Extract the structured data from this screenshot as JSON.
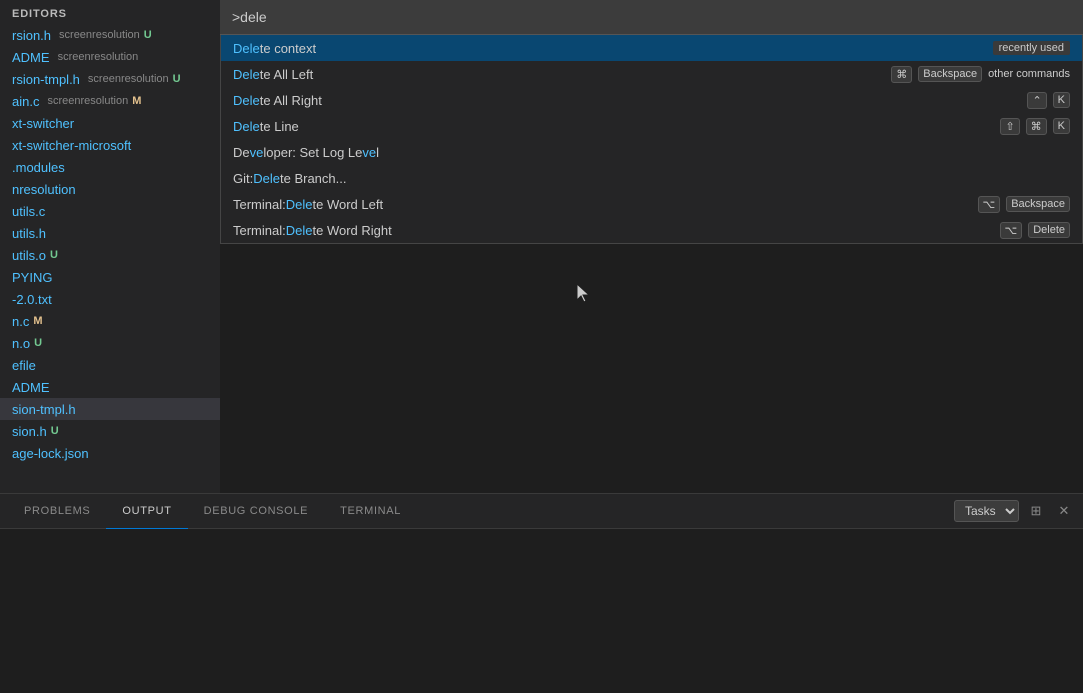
{
  "sidebar": {
    "header": "EDITORS",
    "items": [
      {
        "name": "rsion.h",
        "secondary": "screenresolution",
        "badge": "U",
        "badge_type": "u",
        "active": false
      },
      {
        "name": "ADME",
        "secondary": "screenresolution",
        "badge": "",
        "badge_type": "",
        "active": false
      },
      {
        "name": "rsion-tmpl.h",
        "secondary": "screenresolution",
        "badge": "U",
        "badge_type": "u",
        "active": false
      },
      {
        "name": "ain.c",
        "secondary": "screenresolution",
        "badge": "M",
        "badge_type": "m",
        "active": false
      },
      {
        "name": "xt-switcher",
        "secondary": "",
        "badge": "",
        "badge_type": "",
        "active": false
      },
      {
        "name": "xt-switcher-microsoft",
        "secondary": "",
        "badge": "",
        "badge_type": "",
        "active": false
      },
      {
        "name": ".modules",
        "secondary": "",
        "badge": "",
        "badge_type": "",
        "active": false
      },
      {
        "name": "nresolution",
        "secondary": "",
        "badge": "",
        "badge_type": "",
        "active": false
      },
      {
        "name": "utils.c",
        "secondary": "",
        "badge": "",
        "badge_type": "",
        "active": false
      },
      {
        "name": "utils.h",
        "secondary": "",
        "badge": "",
        "badge_type": "",
        "active": false
      },
      {
        "name": "utils.o",
        "secondary": "",
        "badge": "U",
        "badge_type": "u",
        "active": false
      },
      {
        "name": "PYING",
        "secondary": "",
        "badge": "",
        "badge_type": "",
        "active": false
      },
      {
        "name": "-2.0.txt",
        "secondary": "",
        "badge": "",
        "badge_type": "",
        "active": false
      },
      {
        "name": "n.c",
        "secondary": "",
        "badge": "M",
        "badge_type": "m",
        "active": false
      },
      {
        "name": "n.o",
        "secondary": "",
        "badge": "U",
        "badge_type": "u",
        "active": false
      },
      {
        "name": "efile",
        "secondary": "",
        "badge": "",
        "badge_type": "",
        "active": false
      },
      {
        "name": "ADME",
        "secondary": "",
        "badge": "",
        "badge_type": "",
        "active": false
      },
      {
        "name": "sion-tmpl.h",
        "secondary": "",
        "badge": "",
        "badge_type": "",
        "active": true
      },
      {
        "name": "sion.h",
        "secondary": "",
        "badge": "U",
        "badge_type": "u",
        "active": false
      },
      {
        "name": "age-lock.json",
        "secondary": "",
        "badge": "",
        "badge_type": "",
        "active": false
      }
    ]
  },
  "command_palette": {
    "input_value": ">dele",
    "items": [
      {
        "id": 0,
        "prefix": "",
        "highlight": "Dele",
        "suffix": "te context",
        "badge_right": "recently used",
        "badge_type": "recently_used",
        "highlighted": true,
        "keybindings": []
      },
      {
        "id": 1,
        "prefix": "",
        "highlight": "Dele",
        "suffix": "te All Left",
        "badge_right": "other commands",
        "badge_type": "other_commands",
        "highlighted": false,
        "keybindings": [
          "⌘",
          "Backspace"
        ]
      },
      {
        "id": 2,
        "prefix": "",
        "highlight": "Dele",
        "suffix": "te All Right",
        "badge_right": "",
        "badge_type": "",
        "highlighted": false,
        "keybindings": [
          "⌃",
          "K"
        ]
      },
      {
        "id": 3,
        "prefix": "",
        "highlight": "Dele",
        "suffix": "te Line",
        "badge_right": "",
        "badge_type": "",
        "highlighted": false,
        "keybindings": [
          "⇧",
          "⌘",
          "K"
        ]
      },
      {
        "id": 4,
        "prefix": "De",
        "highlight": "ve",
        "suffix": "loper: Set Log Le",
        "highlight2": "ve",
        "suffix2": "l",
        "badge_right": "",
        "badge_type": "",
        "highlighted": false,
        "keybindings": [],
        "full_text": "Developer: Set Log Level"
      },
      {
        "id": 5,
        "prefix": "Git: ",
        "highlight": "Dele",
        "suffix": "te Branch...",
        "badge_right": "",
        "badge_type": "",
        "highlighted": false,
        "keybindings": []
      },
      {
        "id": 6,
        "prefix": "Terminal: ",
        "highlight": "Dele",
        "suffix": "te Word Left",
        "badge_right": "",
        "badge_type": "",
        "highlighted": false,
        "keybindings": [
          "⌥",
          "Backspace"
        ]
      },
      {
        "id": 7,
        "prefix": "Terminal: ",
        "highlight": "Dele",
        "suffix": "te Word Right",
        "badge_right": "",
        "badge_type": "",
        "highlighted": false,
        "keybindings": [
          "⌥",
          "Delete"
        ]
      }
    ]
  },
  "bottom_panel": {
    "tabs": [
      {
        "label": "PROBLEMS",
        "active": false
      },
      {
        "label": "OUTPUT",
        "active": true
      },
      {
        "label": "DEBUG CONSOLE",
        "active": false
      },
      {
        "label": "TERMINAL",
        "active": false
      }
    ],
    "tasks_label": "Tasks"
  },
  "icons": {
    "top_right": "≡",
    "panel_filter": "☰",
    "panel_close": "✕"
  }
}
